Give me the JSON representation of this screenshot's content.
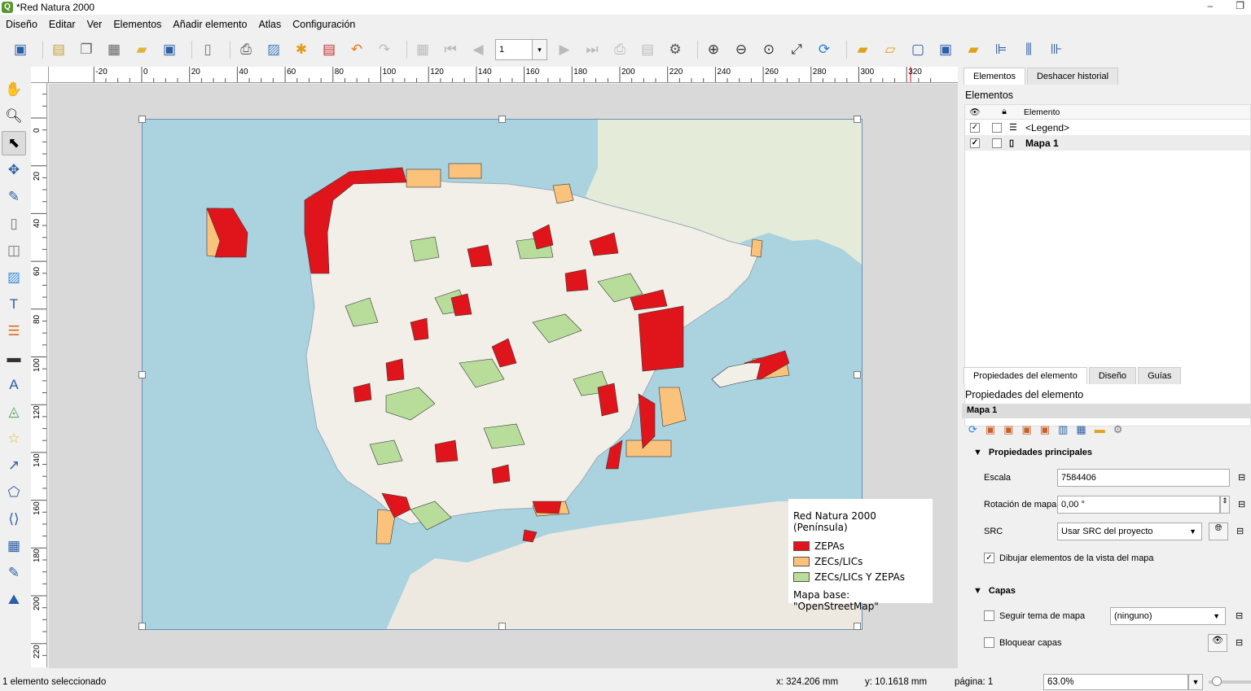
{
  "window": {
    "title": "*Red Natura 2000",
    "minimize": "–",
    "restore": "❐"
  },
  "menu": [
    "Diseño",
    "Editar",
    "Ver",
    "Elementos",
    "Añadir elemento",
    "Atlas",
    "Configuración"
  ],
  "toolbar": {
    "page_value": "1",
    "page_dropdown": "▾"
  },
  "toolbar_icons": [
    "save-icon",
    "new-layout-icon",
    "duplicate-layout-icon",
    "layout-manager-icon",
    "open-template-icon",
    "save-template-icon",
    "add-pages-icon",
    "print-icon",
    "export-image-icon",
    "export-svg-icon",
    "export-pdf-icon",
    "undo-icon",
    "redo-icon",
    "atlas-settings-icon",
    "first-feature-icon",
    "prev-feature-icon",
    "next-feature-icon",
    "last-feature-icon",
    "print-atlas-icon",
    "export-atlas-icon",
    "atlas-settings-icon",
    "zoom-in-icon",
    "zoom-out-icon",
    "zoom-100-icon",
    "zoom-full-icon",
    "refresh-icon",
    "lock-items-icon",
    "unlock-items-icon",
    "group-icon",
    "ungroup-icon",
    "raise-icon",
    "align-left-icon",
    "distribute-icon",
    "resize-icon"
  ],
  "ruler": {
    "h_labels": [
      "-20",
      "0",
      "20",
      "40",
      "60",
      "80",
      "100",
      "120",
      "140",
      "160",
      "180",
      "200",
      "220",
      "240",
      "260",
      "280",
      "300",
      "320"
    ],
    "v_labels": [
      "0",
      "20",
      "40",
      "60",
      "80",
      "100",
      "120",
      "140",
      "160",
      "180",
      "200",
      "220"
    ]
  },
  "legend": {
    "title": "Red Natura 2000 (Península)",
    "items": [
      {
        "label": "ZEPAs",
        "color": "#e0151c"
      },
      {
        "label": "ZECs/LICs",
        "color": "#fbc27c"
      },
      {
        "label": "ZECs/LICs Y ZEPAs",
        "color": "#b8dd9a"
      }
    ],
    "base": "Mapa base: \"OpenStreetMap\""
  },
  "colors": {
    "sea": "#aad3df",
    "land": "#f2efe9",
    "zepa": "#e0151c",
    "zec": "#fbc27c",
    "both": "#b8dd9a"
  },
  "dock": {
    "top_tabs": [
      "Elementos",
      "Deshacer historial"
    ],
    "items_title": "Elementos",
    "col_element": "Elemento",
    "items": [
      {
        "label": "<Legend>",
        "visible": "✓",
        "bold": false
      },
      {
        "label": "Mapa 1",
        "visible": "✓",
        "bold": true
      }
    ],
    "bottom_tabs": [
      "Propiedades del elemento",
      "Diseño",
      "Guías"
    ],
    "props_title": "Propiedades del elemento",
    "selected": "Mapa 1",
    "main_group": "Propiedades principales",
    "scale_label": "Escala",
    "scale_value": "7584406",
    "rotation_label": "Rotación de mapa",
    "rotation_value": "0,00 °",
    "src_label": "SRC",
    "src_value": "Usar SRC del proyecto",
    "draw_label": "Dibujar elementos de la vista del mapa",
    "draw_checked": "✓",
    "layers_group": "Capas",
    "follow_label": "Seguir tema de mapa",
    "follow_value": "(ninguno)",
    "lock_label": "Bloquear capas"
  },
  "status": {
    "selection": "1 elemento seleccionado",
    "x": "x: 324.206 mm",
    "y": "y: 10.1618 mm",
    "page": "página: 1",
    "zoom": "63.0%"
  }
}
